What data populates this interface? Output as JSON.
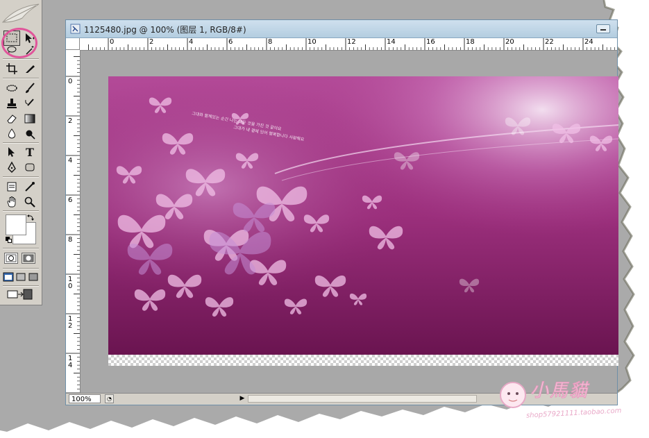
{
  "document": {
    "title": "1125480.jpg @ 100% (图层 1, RGB/8#)",
    "zoom": "100%"
  },
  "rulers": {
    "horizontal": [
      "0",
      "2",
      "4",
      "6",
      "8",
      "10",
      "12",
      "14",
      "16",
      "18",
      "20",
      "22",
      "24"
    ],
    "vertical": [
      "0",
      "2",
      "4",
      "6",
      "8",
      "10",
      "12",
      "14"
    ]
  },
  "artwork": {
    "caption_line_1": "그대와 함께있는 순간 나는 모든 것을 가진 것 같아요",
    "caption_line_2": "그대가 내 곁에 있어 행복합니다 사랑해요"
  },
  "watermark": {
    "text": "小馬貓",
    "url": "shop57921111.taobao.com"
  },
  "colors": {
    "canvas_gray": "#a8a8a8",
    "highlight": "#e0559a",
    "art_base": "#9b2f7c"
  }
}
